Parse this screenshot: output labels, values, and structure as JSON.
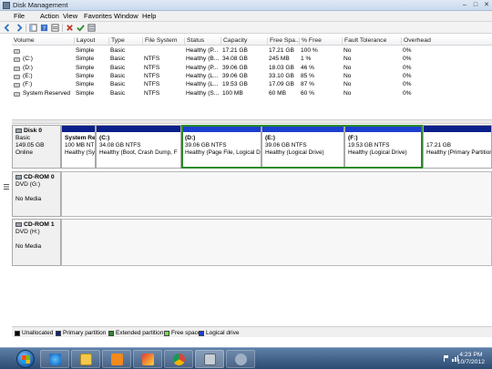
{
  "window": {
    "title": "Disk Management",
    "controls": [
      "–",
      "□",
      "✕"
    ]
  },
  "menu": [
    "File",
    "Action",
    "View",
    "Favorites",
    "Window",
    "Help"
  ],
  "volume_table": {
    "columns": [
      "Volume",
      "Layout",
      "Type",
      "File System",
      "Status",
      "Capacity",
      "Free Spa...",
      "% Free",
      "Fault Tolerance",
      "Overhead"
    ],
    "rows": [
      [
        "",
        "Simple",
        "Basic",
        "",
        "Healthy (P...",
        "17.21 GB",
        "17.21 GB",
        "100 %",
        "No",
        "0%"
      ],
      [
        "(C:)",
        "Simple",
        "Basic",
        "NTFS",
        "Healthy (B...",
        "34.08 GB",
        "245 MB",
        "1 %",
        "No",
        "0%"
      ],
      [
        "(D:)",
        "Simple",
        "Basic",
        "NTFS",
        "Healthy (P...",
        "39.06 GB",
        "18.03 GB",
        "46 %",
        "No",
        "0%"
      ],
      [
        "(E:)",
        "Simple",
        "Basic",
        "NTFS",
        "Healthy (L...",
        "39.06 GB",
        "33.10 GB",
        "85 %",
        "No",
        "0%"
      ],
      [
        "(F:)",
        "Simple",
        "Basic",
        "NTFS",
        "Healthy (L...",
        "19.53 GB",
        "17.09 GB",
        "87 %",
        "No",
        "0%"
      ],
      [
        "System Reserved",
        "Simple",
        "Basic",
        "NTFS",
        "Healthy (S...",
        "100 MB",
        "60 MB",
        "60 %",
        "No",
        "0%"
      ]
    ]
  },
  "disks": [
    {
      "name": "Disk 0",
      "lines": [
        "Basic",
        "149.05 GB",
        "Online"
      ],
      "partitions": [
        {
          "title": "System Re",
          "size": "100 MB NT",
          "status": "Healthy (Sy",
          "color": "#0a1f8a"
        },
        {
          "title": "(C:)",
          "size": "34.08 GB NTFS",
          "status": "Healthy (Boot, Crash Dump, F",
          "color": "#0a1f8a"
        },
        {
          "title": "(D:)",
          "size": "39.06 GB NTFS",
          "status": "Healthy (Page File, Logical Dr",
          "color": "#1b3fd0"
        },
        {
          "title": "(E:)",
          "size": "39.06 GB NTFS",
          "status": "Healthy (Logical Drive)",
          "color": "#1b3fd0"
        },
        {
          "title": "(F:)",
          "size": "19.53 GB NTFS",
          "status": "Healthy (Logical Drive)",
          "color": "#1b3fd0"
        },
        {
          "title": "",
          "size": "17.21 GB",
          "status": "Healthy (Primary Partition",
          "color": "#0a1f8a"
        }
      ]
    },
    {
      "name": "CD-ROM 0",
      "lines": [
        "DVD (G:)",
        "",
        "No Media"
      ]
    },
    {
      "name": "CD-ROM 1",
      "lines": [
        "DVD (H:)",
        "",
        "No Media"
      ]
    }
  ],
  "legend": [
    {
      "label": "Unallocated",
      "color": "#000000"
    },
    {
      "label": "Primary partition",
      "color": "#0a1f8a"
    },
    {
      "label": "Extended partition",
      "color": "#2a8a2a"
    },
    {
      "label": "Free space",
      "color": "#6fdc4a"
    },
    {
      "label": "Logical drive",
      "color": "#1b3fd0"
    }
  ],
  "taskbar": {
    "apps": [
      "ie-icon",
      "folder-icon",
      "media-player-icon",
      "paint-icon",
      "chrome-icon",
      "disk-mgmt-icon",
      "settings-icon"
    ],
    "time": "4:23 PM",
    "date": "10/7/2012"
  }
}
